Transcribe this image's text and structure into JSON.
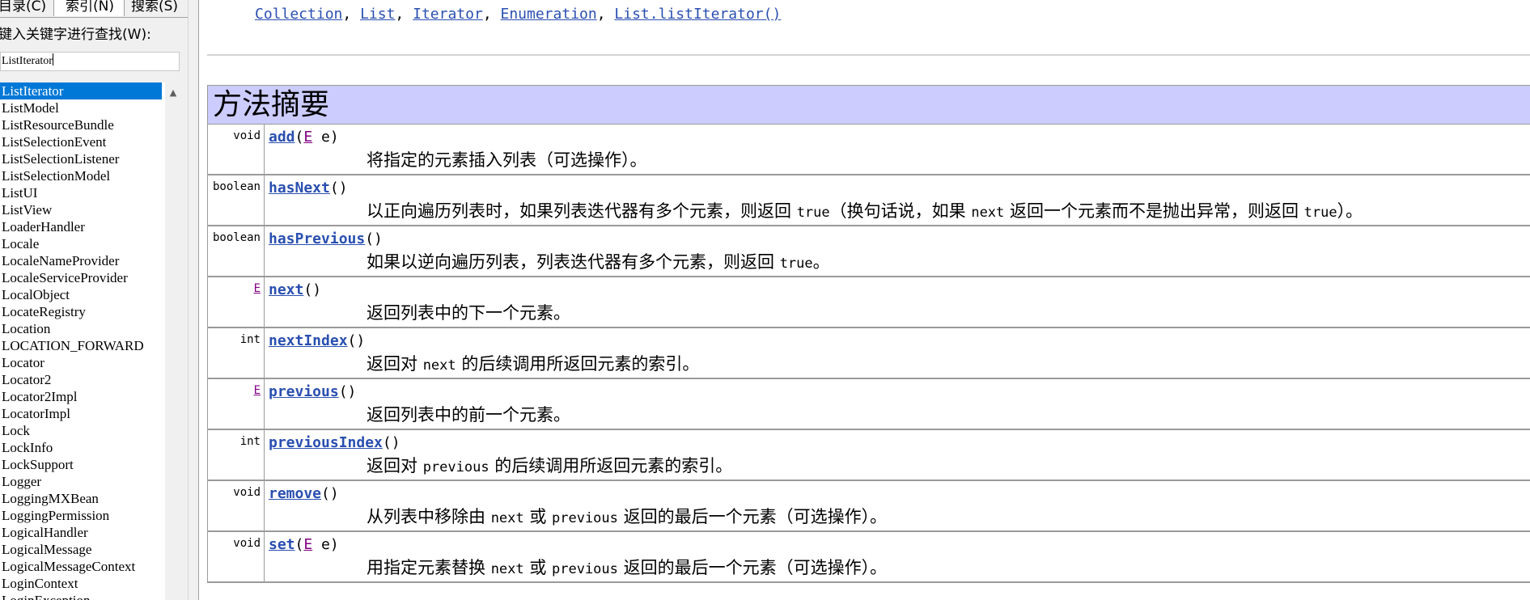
{
  "index_pane": {
    "tabs": [
      "目录(C)",
      "索引(N)",
      "搜索(S)"
    ],
    "keyword_label": "键入关键字进行查找(W):",
    "search_value": "ListIterator",
    "items": [
      "ListIterator",
      "ListModel",
      "ListResourceBundle",
      "ListSelectionEvent",
      "ListSelectionListener",
      "ListSelectionModel",
      "ListUI",
      "ListView",
      "LoaderHandler",
      "Locale",
      "LocaleNameProvider",
      "LocaleServiceProvider",
      "LocalObject",
      "LocateRegistry",
      "Location",
      "LOCATION_FORWARD",
      "Locator",
      "Locator2",
      "Locator2Impl",
      "LocatorImpl",
      "Lock",
      "LockInfo",
      "LockSupport",
      "Logger",
      "LoggingMXBean",
      "LoggingPermission",
      "LogicalHandler",
      "LogicalMessage",
      "LogicalMessageContext",
      "LoginContext",
      "LoginException"
    ],
    "selected_index": 0
  },
  "see_also": [
    "Collection",
    "List",
    "Iterator",
    "Enumeration",
    "List.listIterator()"
  ],
  "see_also_separator": ",",
  "method_summary": {
    "title": "方法摘要",
    "rows": [
      {
        "modifier": "void",
        "name": "add",
        "params_prefix": "(",
        "type_param": "E",
        "params_suffix": " e)",
        "desc_parts": [
          "将指定的元素插入列表（可选操作）。"
        ]
      },
      {
        "modifier": "boolean",
        "name": "hasNext",
        "params_prefix": "()",
        "type_param": "",
        "params_suffix": "",
        "desc_parts": [
          "以正向遍历列表时，如果列表迭代器有多个元素，则返回 ",
          "true",
          "（换句话说，如果 ",
          "next",
          " 返回一个元素而不是抛出异常，则返回 ",
          "true",
          "）。"
        ]
      },
      {
        "modifier": "boolean",
        "name": "hasPrevious",
        "params_prefix": "()",
        "type_param": "",
        "params_suffix": "",
        "desc_parts": [
          "如果以逆向遍历列表，列表迭代器有多个元素，则返回 ",
          "true",
          "。"
        ]
      },
      {
        "modifier": "E",
        "name": "next",
        "params_prefix": "()",
        "type_param": "",
        "params_suffix": "",
        "desc_parts": [
          "返回列表中的下一个元素。"
        ]
      },
      {
        "modifier": "int",
        "name": "nextIndex",
        "params_prefix": "()",
        "type_param": "",
        "params_suffix": "",
        "desc_parts": [
          "返回对 ",
          "next",
          " 的后续调用所返回元素的索引。"
        ]
      },
      {
        "modifier": "E",
        "name": "previous",
        "params_prefix": "()",
        "type_param": "",
        "params_suffix": "",
        "desc_parts": [
          "返回列表中的前一个元素。"
        ]
      },
      {
        "modifier": "int",
        "name": "previousIndex",
        "params_prefix": "()",
        "type_param": "",
        "params_suffix": "",
        "desc_parts": [
          "返回对 ",
          "previous",
          " 的后续调用所返回元素的索引。"
        ]
      },
      {
        "modifier": "void",
        "name": "remove",
        "params_prefix": "()",
        "type_param": "",
        "params_suffix": "",
        "desc_parts": [
          "从列表中移除由 ",
          "next",
          " 或 ",
          "previous",
          " 返回的最后一个元素（可选操作）。"
        ]
      },
      {
        "modifier": "void",
        "name": "set",
        "params_prefix": "(",
        "type_param": "E",
        "params_suffix": " e)",
        "desc_parts": [
          "用指定元素替换 ",
          "next",
          " 或 ",
          "previous",
          " 返回的最后一个元素（可选操作）。"
        ]
      }
    ]
  },
  "colors": {
    "link": "#2a4fb0",
    "visited": "#800080",
    "header_bg": "#ccccff",
    "selection": "#0078d7"
  }
}
